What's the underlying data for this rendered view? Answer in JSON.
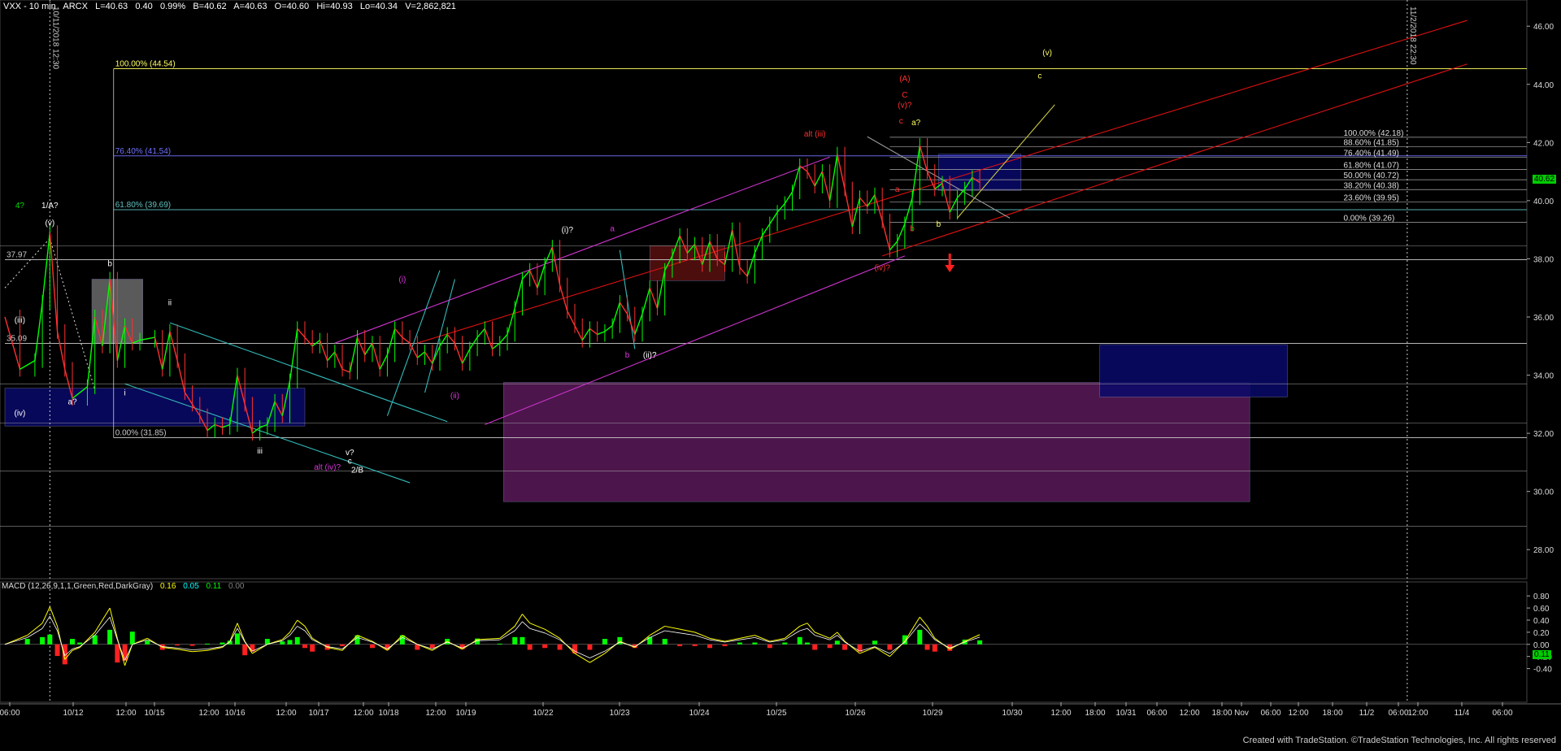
{
  "header": {
    "symbol": "VXX - 10 min",
    "exchange": "ARCX",
    "last": "L=40.63",
    "change": "0.40",
    "change_pct": "0.99%",
    "bid": "B=40.62",
    "ask": "A=40.63",
    "open": "O=40.60",
    "high": "Hi=40.93",
    "low": "Lo=40.34",
    "volume": "V=2,862,821"
  },
  "macd_header": {
    "label": "MACD (12,26,9,1,1,Green,Red,DarkGray)",
    "v1": "0.16",
    "v2": "0.05",
    "v3": "0.11",
    "v4": "0.00",
    "colors": [
      "#ffff00",
      "#00ffff",
      "#00ff00",
      "#808080"
    ]
  },
  "footer": "Created with TradeStation. ©TradeStation Technologies, Inc. All rights reserved",
  "vertical_labels": {
    "left": "10/11/2018 12:30",
    "right": "11/2/2018 22:30"
  },
  "price_markers": {
    "last_price": "40.62",
    "last_color": "#00cc00",
    "macd_last": "0.11"
  },
  "colors": {
    "background": "#000000",
    "price_up": "#00ff00",
    "price_down": "#ff3030",
    "fib_white": "#c8c8c8",
    "fib_yellow": "#ffff60",
    "fib_blue": "#7070ff",
    "fib_teal": "#60c0c0",
    "channel_red": "#dd1111",
    "channel_magenta": "#cc33cc",
    "channel_cyan": "#33bbbb",
    "zone_purple": "#5a1a5a",
    "zone_blue": "#0a0a6a",
    "zone_gray": "#6a6a6a",
    "zone_darkred": "#5a1010"
  },
  "chart_data": [
    {
      "type": "line",
      "panel": "price",
      "y_ticks": [
        "28.00",
        "30.00",
        "32.00",
        "34.00",
        "36.00",
        "38.00",
        "40.00",
        "42.00",
        "44.00",
        "46.00"
      ],
      "ylim": [
        27.0,
        46.9
      ],
      "x_ticks": [
        "06:00",
        "10/12",
        "12:00",
        "10/15",
        "12:00",
        "10/16",
        "12:00",
        "10/17",
        "12:00",
        "10/18",
        "12:00",
        "10/19",
        "10/22",
        "10/23",
        "10/24",
        "10/25",
        "10/26",
        "10/29",
        "10/30",
        "12:00",
        "18:00",
        "10/31",
        "06:00",
        "12:00",
        "18:00",
        "Nov",
        "06:00",
        "12:00",
        "18:00",
        "11/2",
        "06:00",
        "12:00",
        "11/4",
        "06:00"
      ],
      "x_tick_ids": [
        0,
        1,
        2,
        3,
        4,
        5,
        6,
        7,
        8,
        9,
        10,
        11,
        12,
        13,
        14,
        15,
        16,
        17,
        18,
        19,
        20,
        21,
        22,
        23,
        24,
        25,
        26,
        27,
        28,
        29,
        30,
        31,
        32,
        33
      ],
      "price_path": [
        [
          0,
          36.0
        ],
        [
          2,
          34.2
        ],
        [
          4,
          34.5
        ],
        [
          5,
          36.5
        ],
        [
          6,
          38.9
        ],
        [
          7,
          35.5
        ],
        [
          8,
          34.2
        ],
        [
          9,
          33.2
        ],
        [
          11,
          33.6
        ],
        [
          12,
          36.0
        ],
        [
          13,
          35.0
        ],
        [
          14,
          37.3
        ],
        [
          15,
          34.5
        ],
        [
          16,
          35.7
        ],
        [
          17,
          35.1
        ],
        [
          18,
          35.2
        ],
        [
          20,
          35.3
        ],
        [
          21,
          34.2
        ],
        [
          22,
          35.5
        ],
        [
          23,
          34.5
        ],
        [
          24,
          33.4
        ],
        [
          25,
          33.0
        ],
        [
          26,
          32.6
        ],
        [
          27,
          32.1
        ],
        [
          28,
          32.3
        ],
        [
          29,
          32.2
        ],
        [
          30,
          32.3
        ],
        [
          31,
          34.0
        ],
        [
          32,
          33.0
        ],
        [
          33,
          32.0
        ],
        [
          34,
          32.2
        ],
        [
          35,
          32.3
        ],
        [
          36,
          33.1
        ],
        [
          37,
          32.6
        ],
        [
          38,
          33.8
        ],
        [
          39,
          35.6
        ],
        [
          40,
          35.3
        ],
        [
          41,
          35.0
        ],
        [
          42,
          35.2
        ],
        [
          43,
          34.5
        ],
        [
          44,
          34.8
        ],
        [
          45,
          34.2
        ],
        [
          46,
          34.1
        ],
        [
          47,
          35.3
        ],
        [
          48,
          34.7
        ],
        [
          49,
          35.1
        ],
        [
          50,
          34.2
        ],
        [
          51,
          34.7
        ],
        [
          52,
          35.6
        ],
        [
          53,
          35.3
        ],
        [
          54,
          35.1
        ],
        [
          55,
          34.6
        ],
        [
          56,
          34.8
        ],
        [
          57,
          34.4
        ],
        [
          58,
          35.0
        ],
        [
          59,
          35.4
        ],
        [
          60,
          35.1
        ],
        [
          61,
          34.4
        ],
        [
          62,
          34.9
        ],
        [
          63,
          35.3
        ],
        [
          64,
          35.6
        ],
        [
          65,
          34.9
        ],
        [
          66,
          35.1
        ],
        [
          67,
          35.4
        ],
        [
          68,
          36.3
        ],
        [
          69,
          37.3
        ],
        [
          70,
          37.6
        ],
        [
          71,
          37.0
        ],
        [
          72,
          37.8
        ],
        [
          73,
          38.4
        ],
        [
          74,
          37.1
        ],
        [
          75,
          36.2
        ],
        [
          76,
          35.7
        ],
        [
          77,
          35.2
        ],
        [
          78,
          35.6
        ],
        [
          79,
          35.4
        ],
        [
          80,
          35.5
        ],
        [
          81,
          35.7
        ],
        [
          82,
          36.5
        ],
        [
          83,
          36.1
        ],
        [
          84,
          35.4
        ],
        [
          85,
          36.1
        ],
        [
          86,
          37.0
        ],
        [
          87,
          36.3
        ],
        [
          88,
          37.6
        ],
        [
          89,
          38.1
        ],
        [
          90,
          38.8
        ],
        [
          91,
          38.2
        ],
        [
          92,
          38.5
        ],
        [
          93,
          37.8
        ],
        [
          94,
          38.6
        ],
        [
          95,
          38.0
        ],
        [
          96,
          37.8
        ],
        [
          97,
          39.0
        ],
        [
          98,
          37.7
        ],
        [
          99,
          37.4
        ],
        [
          100,
          38.2
        ],
        [
          101,
          38.8
        ],
        [
          102,
          39.2
        ],
        [
          103,
          39.6
        ],
        [
          104,
          39.9
        ],
        [
          105,
          40.3
        ],
        [
          106,
          41.2
        ],
        [
          107,
          41.0
        ],
        [
          108,
          40.5
        ],
        [
          109,
          41.0
        ],
        [
          110,
          40.0
        ],
        [
          111,
          41.6
        ],
        [
          112,
          40.4
        ],
        [
          113,
          39.1
        ],
        [
          114,
          40.1
        ],
        [
          115,
          39.8
        ],
        [
          116,
          40.2
        ],
        [
          117,
          39.3
        ],
        [
          118,
          38.3
        ],
        [
          119,
          38.6
        ],
        [
          120,
          39.2
        ],
        [
          121,
          40.1
        ],
        [
          122,
          41.9
        ],
        [
          123,
          41.0
        ],
        [
          124,
          40.4
        ],
        [
          125,
          40.6
        ],
        [
          126,
          39.6
        ],
        [
          127,
          40.1
        ],
        [
          128,
          40.4
        ],
        [
          129,
          40.8
        ],
        [
          130,
          40.62
        ]
      ],
      "x_index_range": [
        0,
        201
      ],
      "macd_ylim": [
        -0.58,
        0.95
      ],
      "macd_ticks": [
        "-0.40",
        "-0.20",
        "0.00",
        "0.20",
        "0.40",
        "0.60",
        "0.80"
      ],
      "macd_path": [
        [
          0,
          0.0
        ],
        [
          3,
          0.15
        ],
        [
          5,
          0.35
        ],
        [
          6,
          0.62
        ],
        [
          7,
          0.3
        ],
        [
          8,
          -0.25
        ],
        [
          9,
          -0.1
        ],
        [
          10,
          -0.05
        ],
        [
          12,
          0.2
        ],
        [
          14,
          0.6
        ],
        [
          15,
          0.1
        ],
        [
          16,
          -0.35
        ],
        [
          17,
          0.0
        ],
        [
          19,
          0.1
        ],
        [
          21,
          -0.05
        ],
        [
          23,
          -0.08
        ],
        [
          25,
          -0.12
        ],
        [
          27,
          -0.1
        ],
        [
          29,
          -0.05
        ],
        [
          30,
          0.05
        ],
        [
          31,
          0.35
        ],
        [
          32,
          0.05
        ],
        [
          33,
          -0.15
        ],
        [
          35,
          0.0
        ],
        [
          37,
          0.08
        ],
        [
          38,
          0.2
        ],
        [
          39,
          0.4
        ],
        [
          40,
          0.3
        ],
        [
          41,
          0.1
        ],
        [
          43,
          -0.05
        ],
        [
          45,
          -0.1
        ],
        [
          47,
          0.15
        ],
        [
          49,
          0.05
        ],
        [
          51,
          -0.1
        ],
        [
          53,
          0.15
        ],
        [
          55,
          0.0
        ],
        [
          57,
          -0.1
        ],
        [
          59,
          0.05
        ],
        [
          61,
          -0.08
        ],
        [
          63,
          0.08
        ],
        [
          66,
          0.1
        ],
        [
          68,
          0.3
        ],
        [
          69,
          0.5
        ],
        [
          70,
          0.35
        ],
        [
          72,
          0.25
        ],
        [
          74,
          0.1
        ],
        [
          76,
          -0.15
        ],
        [
          78,
          -0.3
        ],
        [
          80,
          -0.15
        ],
        [
          82,
          0.05
        ],
        [
          84,
          -0.05
        ],
        [
          86,
          0.15
        ],
        [
          88,
          0.3
        ],
        [
          90,
          0.25
        ],
        [
          92,
          0.2
        ],
        [
          94,
          0.1
        ],
        [
          96,
          0.05
        ],
        [
          98,
          0.1
        ],
        [
          100,
          0.15
        ],
        [
          102,
          0.05
        ],
        [
          104,
          0.1
        ],
        [
          106,
          0.3
        ],
        [
          107,
          0.35
        ],
        [
          108,
          0.2
        ],
        [
          110,
          0.1
        ],
        [
          111,
          0.2
        ],
        [
          112,
          0.05
        ],
        [
          114,
          -0.15
        ],
        [
          116,
          -0.05
        ],
        [
          118,
          -0.2
        ],
        [
          120,
          0.05
        ],
        [
          122,
          0.45
        ],
        [
          123,
          0.3
        ],
        [
          124,
          0.1
        ],
        [
          126,
          -0.08
        ],
        [
          128,
          0.05
        ],
        [
          130,
          0.16
        ]
      ]
    }
  ],
  "levels": [
    {
      "text": "100.00% (44.54)",
      "price": 44.54,
      "color": "#ffff60"
    },
    {
      "text": "76.40% (41.54)",
      "price": 41.54,
      "color": "#7070ff"
    },
    {
      "text": "61.80% (39.69)",
      "price": 39.69,
      "color": "#60c0c0"
    },
    {
      "text": "0.00% (31.85)",
      "price": 31.85,
      "color": "#c8c8c8"
    },
    {
      "text": "37.97",
      "price": 37.97,
      "color": "#c8c8c8"
    },
    {
      "text": "35.09",
      "price": 35.09,
      "color": "#c8c8c8"
    }
  ],
  "fib_right": [
    {
      "text": "100.00% (42.18)",
      "price": 42.18
    },
    {
      "text": "88.60% (41.85)",
      "price": 41.85
    },
    {
      "text": "76.40% (41.49)",
      "price": 41.49
    },
    {
      "text": "61.80% (41.07)",
      "price": 41.07
    },
    {
      "text": "50.00% (40.72)",
      "price": 40.72
    },
    {
      "text": "38.20% (40.38)",
      "price": 40.38
    },
    {
      "text": "23.60% (39.95)",
      "price": 39.95
    },
    {
      "text": "0.00% (39.26)",
      "price": 39.26
    }
  ],
  "wave_labels": [
    {
      "text": "4?",
      "x": 2,
      "price": 39.75,
      "color": "#00dd00"
    },
    {
      "text": "1/A?",
      "x": 6,
      "price": 39.75,
      "color": "#ffffff"
    },
    {
      "text": "(v)",
      "x": 6,
      "price": 39.15,
      "color": "#ffffff"
    },
    {
      "text": "(iii)",
      "x": 2,
      "price": 35.8,
      "color": "#ffffff"
    },
    {
      "text": "(iv)",
      "x": 2,
      "price": 32.6,
      "color": "#ffffff"
    },
    {
      "text": "a?",
      "x": 9,
      "price": 33.0,
      "color": "#ffffff"
    },
    {
      "text": "b",
      "x": 14,
      "price": 37.75,
      "color": "#ffffff"
    },
    {
      "text": "i",
      "x": 16,
      "price": 33.3,
      "color": "#ffffff"
    },
    {
      "text": "ii",
      "x": 22,
      "price": 36.4,
      "color": "#ffffff"
    },
    {
      "text": "iii",
      "x": 34,
      "price": 31.3,
      "color": "#ffffff"
    },
    {
      "text": "v?",
      "x": 46,
      "price": 31.25,
      "color": "#ffffff"
    },
    {
      "text": "c",
      "x": 46,
      "price": 30.95,
      "color": "#ffffff"
    },
    {
      "text": "2/B",
      "x": 47,
      "price": 30.65,
      "color": "#ffffff"
    },
    {
      "text": "alt (iv)?",
      "x": 43,
      "price": 30.75,
      "color": "#dd33dd"
    },
    {
      "text": "(i)",
      "x": 53,
      "price": 37.2,
      "color": "#dd33dd"
    },
    {
      "text": "(ii)",
      "x": 60,
      "price": 33.2,
      "color": "#dd33dd"
    },
    {
      "text": "(i)?",
      "x": 75,
      "price": 38.9,
      "color": "#ffffff"
    },
    {
      "text": "a",
      "x": 81,
      "price": 38.95,
      "color": "#dd33dd"
    },
    {
      "text": "b",
      "x": 83,
      "price": 34.6,
      "color": "#dd33dd"
    },
    {
      "text": "(ii)?",
      "x": 86,
      "price": 34.6,
      "color": "#ffffff"
    },
    {
      "text": "alt (iii)",
      "x": 108,
      "price": 42.2,
      "color": "#ff3030"
    },
    {
      "text": "(A)",
      "x": 120,
      "price": 44.1,
      "color": "#ff3030"
    },
    {
      "text": "C",
      "x": 120,
      "price": 43.55,
      "color": "#ff3030"
    },
    {
      "text": "(v)?",
      "x": 120,
      "price": 43.2,
      "color": "#ff3030"
    },
    {
      "text": "c",
      "x": 119.5,
      "price": 42.65,
      "color": "#ff3030"
    },
    {
      "text": "a?",
      "x": 121.5,
      "price": 42.6,
      "color": "#ffff60"
    },
    {
      "text": "a",
      "x": 119,
      "price": 40.3,
      "color": "#ff3030"
    },
    {
      "text": "b",
      "x": 121,
      "price": 38.95,
      "color": "#ff3030"
    },
    {
      "text": "b",
      "x": 124.5,
      "price": 39.1,
      "color": "#ffff60"
    },
    {
      "text": "(iv)?",
      "x": 117,
      "price": 37.6,
      "color": "#ff3030"
    },
    {
      "text": "(v)",
      "x": 139,
      "price": 45.0,
      "color": "#ffff60"
    },
    {
      "text": "c",
      "x": 138,
      "price": 44.2,
      "color": "#ffff60"
    }
  ]
}
